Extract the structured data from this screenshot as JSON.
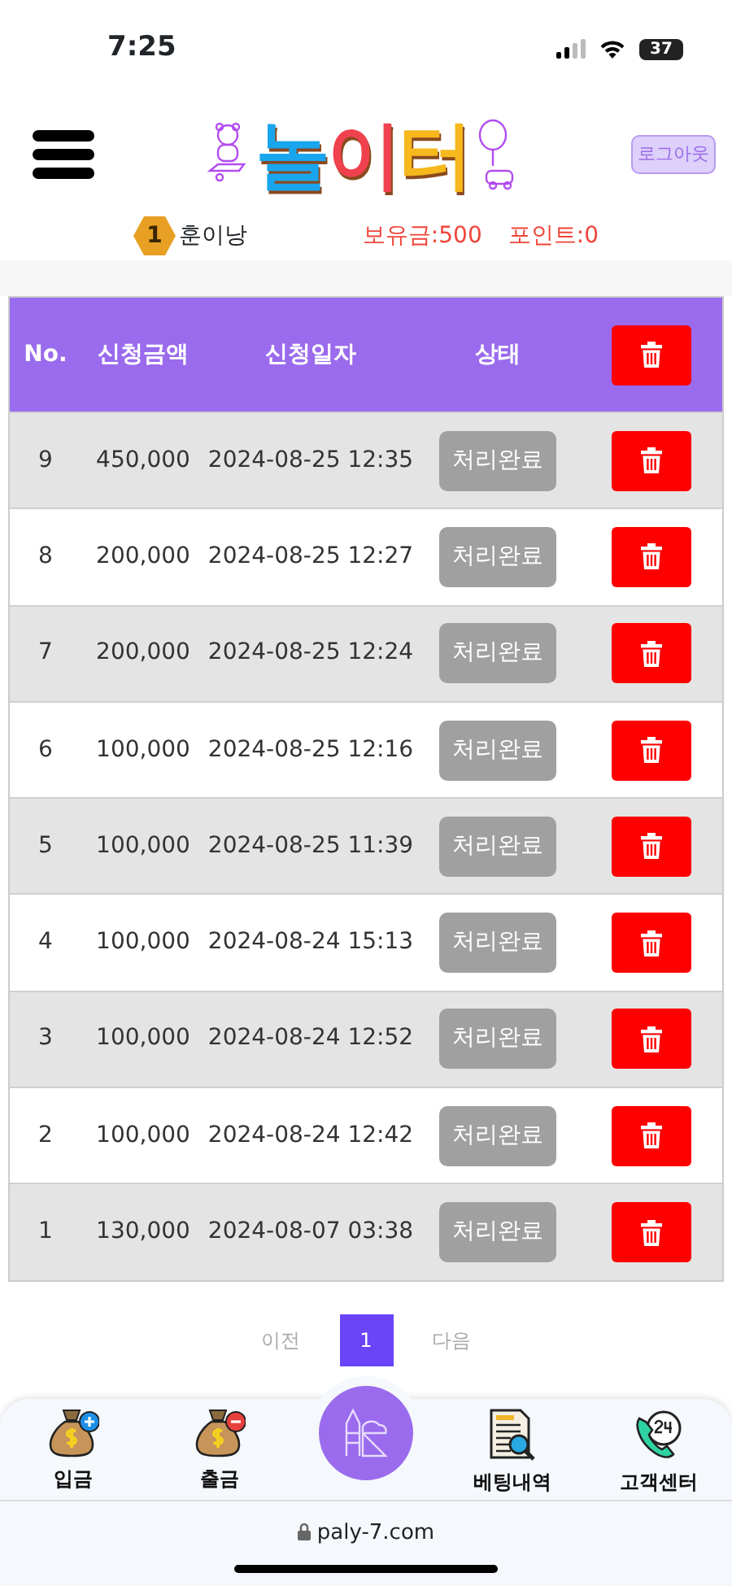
{
  "status_bar": {
    "time": "7:25",
    "battery": "37"
  },
  "header": {
    "logo": "놀이터",
    "logout": "로그아웃",
    "level": "1",
    "username": "훈이낭",
    "balance": "보유금:500",
    "points": "포인트:0"
  },
  "table": {
    "columns": [
      "No.",
      "신청금액",
      "신청일자",
      "상태"
    ],
    "rows": [
      {
        "no": "9",
        "amount": "450,000",
        "date": "2024-08-25 12:35",
        "status": "처리완료"
      },
      {
        "no": "8",
        "amount": "200,000",
        "date": "2024-08-25 12:27",
        "status": "처리완료"
      },
      {
        "no": "7",
        "amount": "200,000",
        "date": "2024-08-25 12:24",
        "status": "처리완료"
      },
      {
        "no": "6",
        "amount": "100,000",
        "date": "2024-08-25 12:16",
        "status": "처리완료"
      },
      {
        "no": "5",
        "amount": "100,000",
        "date": "2024-08-25 11:39",
        "status": "처리완료"
      },
      {
        "no": "4",
        "amount": "100,000",
        "date": "2024-08-24 15:13",
        "status": "처리완료"
      },
      {
        "no": "3",
        "amount": "100,000",
        "date": "2024-08-24 12:52",
        "status": "처리완료"
      },
      {
        "no": "2",
        "amount": "100,000",
        "date": "2024-08-24 12:42",
        "status": "처리완료"
      },
      {
        "no": "1",
        "amount": "130,000",
        "date": "2024-08-07 03:38",
        "status": "처리완료"
      }
    ]
  },
  "pagination": {
    "prev": "이전",
    "pages": [
      {
        "label": "1",
        "selected": true
      }
    ],
    "next": "다음"
  },
  "bottom_nav": [
    {
      "kind": "deposit",
      "label": "입금"
    },
    {
      "kind": "withdraw",
      "label": "출금"
    },
    {
      "kind": "center"
    },
    {
      "kind": "history",
      "label": "베팅내역"
    },
    {
      "kind": "support",
      "label": "고객센터"
    }
  ],
  "url_bar": {
    "url": "paly-7.com"
  }
}
